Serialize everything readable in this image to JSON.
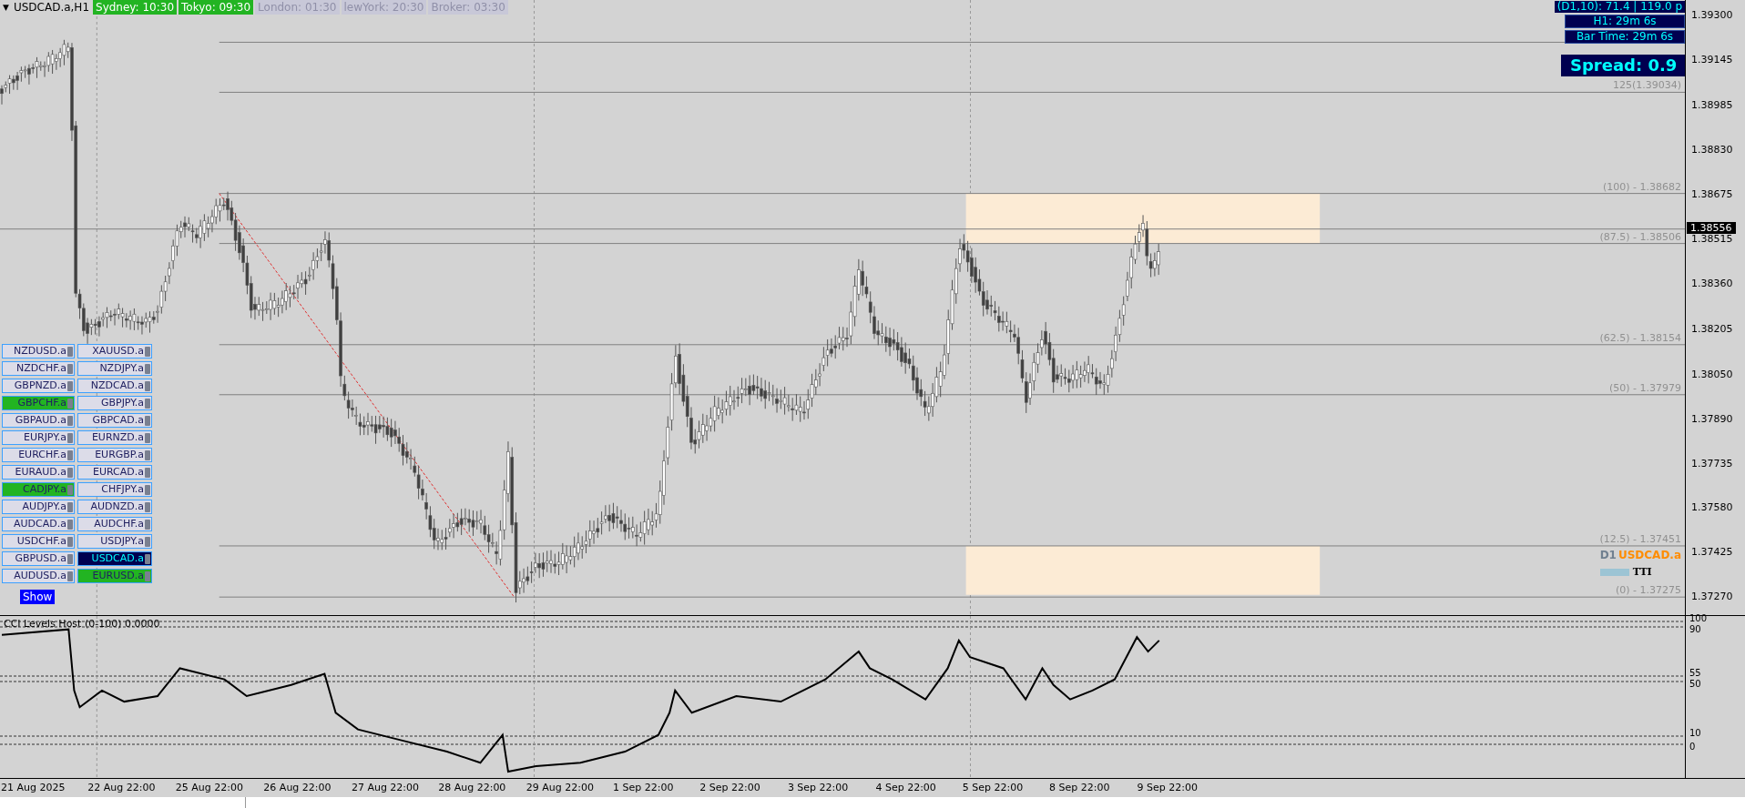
{
  "chart": {
    "menu_glyph": "▼",
    "symbol": "USDCAD.a,H1"
  },
  "sessions": [
    {
      "label": "Sydney: 10:30",
      "active": true
    },
    {
      "label": "Tokyo: 09:30",
      "active": true
    },
    {
      "label": "London: 01:30",
      "active": false
    },
    {
      "label": "lewYork: 20:30",
      "active": false
    },
    {
      "label": "Broker: 03:30",
      "active": false
    }
  ],
  "info_panel": {
    "range": "(D1,10): 71.4  |  119.0 p",
    "h1_timer": "H1:  29m 6s",
    "bar_time": "Bar Time: 29m 6s",
    "spread": "Spread: 0.9"
  },
  "fib_levels": [
    "125(1.39034)",
    "(100) - 1.38682",
    "(87.5) - 1.38506",
    "(62.5) - 1.38154",
    "(50) - 1.37979",
    "(12.5) - 1.37451",
    "(0) - 1.37275"
  ],
  "price_axis": [
    "1.39300",
    "1.39145",
    "1.38985",
    "1.38830",
    "1.38675",
    "1.38515",
    "1.38360",
    "1.38205",
    "1.38050",
    "1.37890",
    "1.37735",
    "1.37580",
    "1.37425",
    "1.37270"
  ],
  "current_price": "1.38556",
  "symbols": [
    {
      "label": "NZDUSD.a",
      "highlighted": false,
      "selected": false
    },
    {
      "label": "XAUUSD.a",
      "highlighted": false,
      "selected": false
    },
    {
      "label": "NZDCHF.a",
      "highlighted": false,
      "selected": false
    },
    {
      "label": "NZDJPY.a",
      "highlighted": false,
      "selected": false
    },
    {
      "label": "GBPNZD.a",
      "highlighted": false,
      "selected": false
    },
    {
      "label": "NZDCAD.a",
      "highlighted": false,
      "selected": false
    },
    {
      "label": "GBPCHF.a",
      "highlighted": true,
      "selected": false
    },
    {
      "label": "GBPJPY.a",
      "highlighted": false,
      "selected": false
    },
    {
      "label": "GBPAUD.a",
      "highlighted": false,
      "selected": false
    },
    {
      "label": "GBPCAD.a",
      "highlighted": false,
      "selected": false
    },
    {
      "label": "EURJPY.a",
      "highlighted": false,
      "selected": false
    },
    {
      "label": "EURNZD.a",
      "highlighted": false,
      "selected": false
    },
    {
      "label": "EURCHF.a",
      "highlighted": false,
      "selected": false
    },
    {
      "label": "EURGBP.a",
      "highlighted": false,
      "selected": false
    },
    {
      "label": "EURAUD.a",
      "highlighted": false,
      "selected": false
    },
    {
      "label": "EURCAD.a",
      "highlighted": false,
      "selected": false
    },
    {
      "label": "CADJPY.a",
      "highlighted": true,
      "selected": false
    },
    {
      "label": "CHFJPY.a",
      "highlighted": false,
      "selected": false
    },
    {
      "label": "AUDJPY.a",
      "highlighted": false,
      "selected": false
    },
    {
      "label": "AUDNZD.a",
      "highlighted": false,
      "selected": false
    },
    {
      "label": "AUDCAD.a",
      "highlighted": false,
      "selected": false
    },
    {
      "label": "AUDCHF.a",
      "highlighted": false,
      "selected": false
    },
    {
      "label": "USDCHF.a",
      "highlighted": false,
      "selected": false
    },
    {
      "label": "USDJPY.a",
      "highlighted": false,
      "selected": false
    },
    {
      "label": "GBPUSD.a",
      "highlighted": false,
      "selected": false
    },
    {
      "label": "USDCAD.a",
      "highlighted": false,
      "selected": true
    },
    {
      "label": "AUDUSD.a",
      "highlighted": false,
      "selected": false
    },
    {
      "label": "EURUSD.a",
      "highlighted": true,
      "selected": false
    }
  ],
  "show_button": "Show",
  "legend": {
    "timeframe": "D1",
    "symbol": "USDCAD.a",
    "tag": "TTI"
  },
  "indicator": {
    "title": "CCI Levels Host (0-100) 0.0000",
    "levels": [
      "100",
      "90",
      "55",
      "50",
      "10",
      "0"
    ]
  },
  "time_axis": [
    "21 Aug 2025",
    "22 Aug 22:00",
    "25 Aug 22:00",
    "26 Aug 22:00",
    "27 Aug 22:00",
    "28 Aug 22:00",
    "29 Aug 22:00",
    "1 Sep 22:00",
    "2 Sep 22:00",
    "3 Sep 22:00",
    "4 Sep 22:00",
    "5 Sep 22:00",
    "8 Sep 22:00",
    "9 Sep 22:00"
  ]
}
